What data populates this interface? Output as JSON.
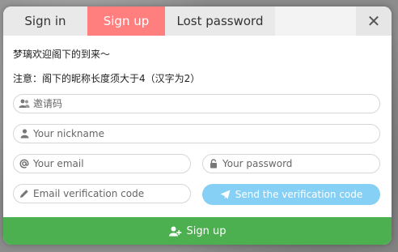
{
  "tabs": {
    "signin": "Sign in",
    "signup": "Sign up",
    "lost": "Lost password"
  },
  "close_label": "✕",
  "welcome": "梦璃欢迎阁下的到来～",
  "notice": "注意：阁下的昵称长度须大于4（汉字为2）",
  "fields": {
    "invite_placeholder": "邀请码",
    "nickname_placeholder": "Your nickname",
    "email_placeholder": "Your email",
    "password_placeholder": "Your password",
    "code_placeholder": "Email verification code"
  },
  "send_button": "Send the verification code",
  "submit_button": "Sign up",
  "colors": {
    "active_tab": "#ff7f7f",
    "send_button": "#86d0f5",
    "submit_button": "#4caf50"
  },
  "icons": [
    "users-icon",
    "user-icon",
    "at-icon",
    "lock-icon",
    "pencil-icon",
    "paper-plane-icon",
    "user-plus-icon",
    "close-icon"
  ]
}
